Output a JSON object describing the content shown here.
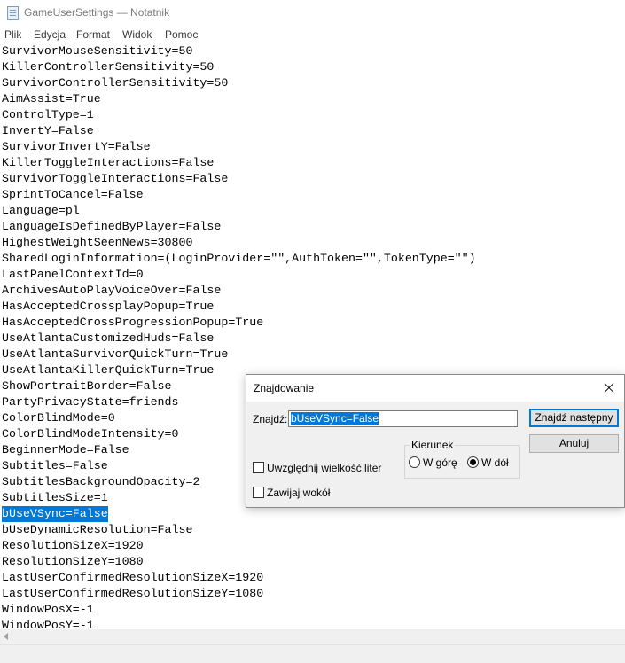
{
  "window": {
    "title": "GameUserSettings — Notatnik"
  },
  "menu": {
    "items": [
      "Plik",
      "Edycja",
      "Format",
      "Widok",
      "Pomoc"
    ]
  },
  "editor": {
    "lines": [
      "SurvivorMouseSensitivity=50",
      "KillerControllerSensitivity=50",
      "SurvivorControllerSensitivity=50",
      "AimAssist=True",
      "ControlType=1",
      "InvertY=False",
      "SurvivorInvertY=False",
      "KillerToggleInteractions=False",
      "SurvivorToggleInteractions=False",
      "SprintToCancel=False",
      "Language=pl",
      "LanguageIsDefinedByPlayer=False",
      "HighestWeightSeenNews=30800",
      "SharedLoginInformation=(LoginProvider=\"\",AuthToken=\"\",TokenType=\"\")",
      "LastPanelContextId=0",
      "ArchivesAutoPlayVoiceOver=False",
      "HasAcceptedCrossplayPopup=True",
      "HasAcceptedCrossProgressionPopup=True",
      "UseAtlantaCustomizedHuds=False",
      "UseAtlantaSurvivorQuickTurn=True",
      "UseAtlantaKillerQuickTurn=True",
      "ShowPortraitBorder=False",
      "PartyPrivacyState=friends",
      "ColorBlindMode=0",
      "ColorBlindModeIntensity=0",
      "BeginnerMode=False",
      "Subtitles=False",
      "SubtitlesBackgroundOpacity=2",
      "SubtitlesSize=1",
      "bUseVSync=False",
      "bUseDynamicResolution=False",
      "ResolutionSizeX=1920",
      "ResolutionSizeY=1080",
      "LastUserConfirmedResolutionSizeX=1920",
      "LastUserConfirmedResolutionSizeY=1080",
      "WindowPosX=-1",
      "WindowPosY=-1"
    ],
    "selected_line": 29
  },
  "find_dialog": {
    "title": "Znajdowanie",
    "find_label": "Znajdź:",
    "find_value": "bUseVSync=False",
    "find_next_label": "Znajdź następny",
    "cancel_label": "Anuluj",
    "direction_group_label": "Kierunek",
    "direction_up_label": "W górę",
    "direction_down_label": "W dół",
    "direction_selected": "down",
    "match_case_label": "Uwzględnij wielkość liter",
    "match_case_checked": false,
    "wrap_around_label": "Zawijaj wokół",
    "wrap_around_checked": false
  },
  "colors": {
    "selection": "#0078d7",
    "dialog_bg": "#f0f0f0"
  }
}
